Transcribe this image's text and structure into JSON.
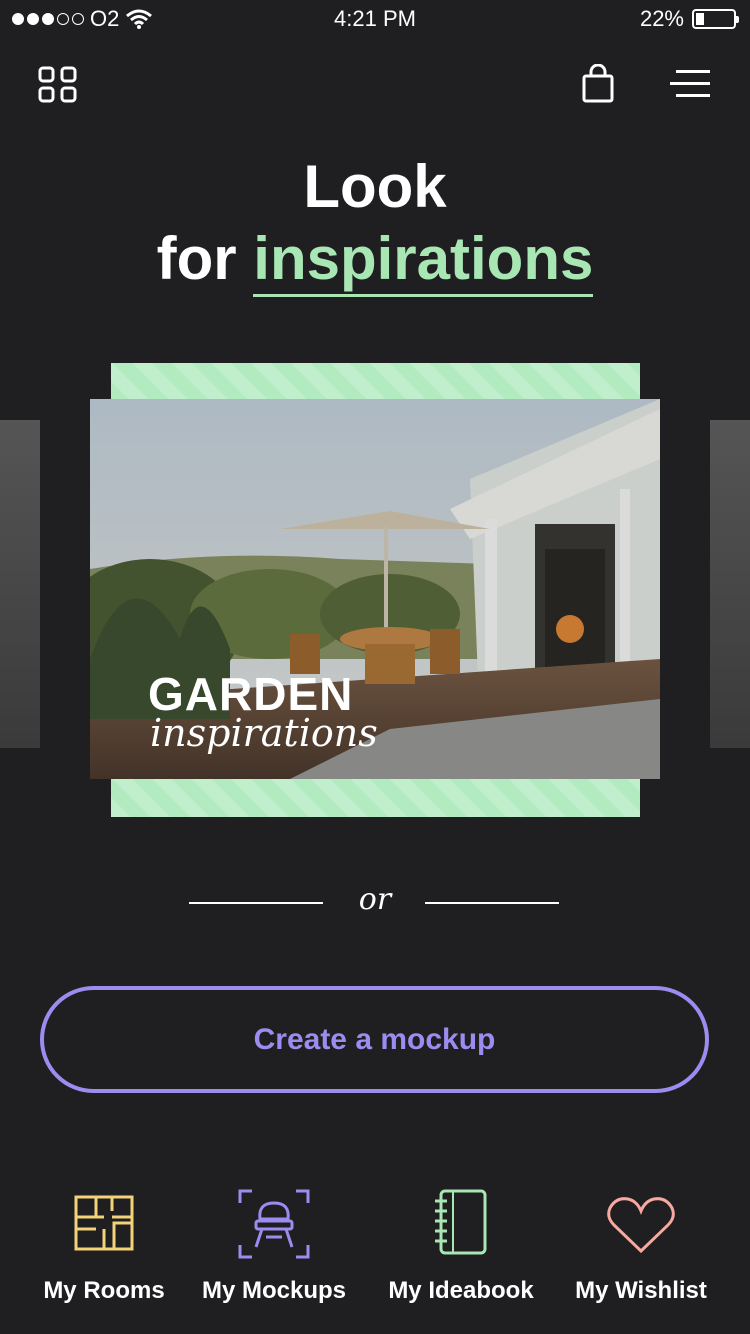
{
  "status_bar": {
    "carrier": "O2",
    "time": "4:21 PM",
    "battery": "22%",
    "battery_level": 0.22,
    "signal_bars": 3
  },
  "header": {
    "grid_icon": "grid-icon",
    "bag_icon": "shopping-bag-icon",
    "menu_icon": "menu-icon"
  },
  "title": {
    "line1": "Look",
    "line2_prefix": "for ",
    "line2_highlight": "inspirations"
  },
  "carousel": {
    "card_title": "GARDEN",
    "card_subtitle": "inspirations"
  },
  "divider": {
    "text": "or"
  },
  "cta": {
    "label": "Create a mockup"
  },
  "tabs": [
    {
      "label": "My Rooms",
      "icon": "floorplan-icon",
      "color": "#f3d27a"
    },
    {
      "label": "My Mockups",
      "icon": "chair-icon",
      "color": "#9d8cf0"
    },
    {
      "label": "My Ideabook",
      "icon": "notebook-icon",
      "color": "#a8e6b4"
    },
    {
      "label": "My Wishlist",
      "icon": "heart-icon",
      "color": "#f7a8a0"
    }
  ],
  "colors": {
    "background": "#1f1f21",
    "accent_green": "#a8e6b4",
    "accent_purple": "#9d8cf0"
  }
}
